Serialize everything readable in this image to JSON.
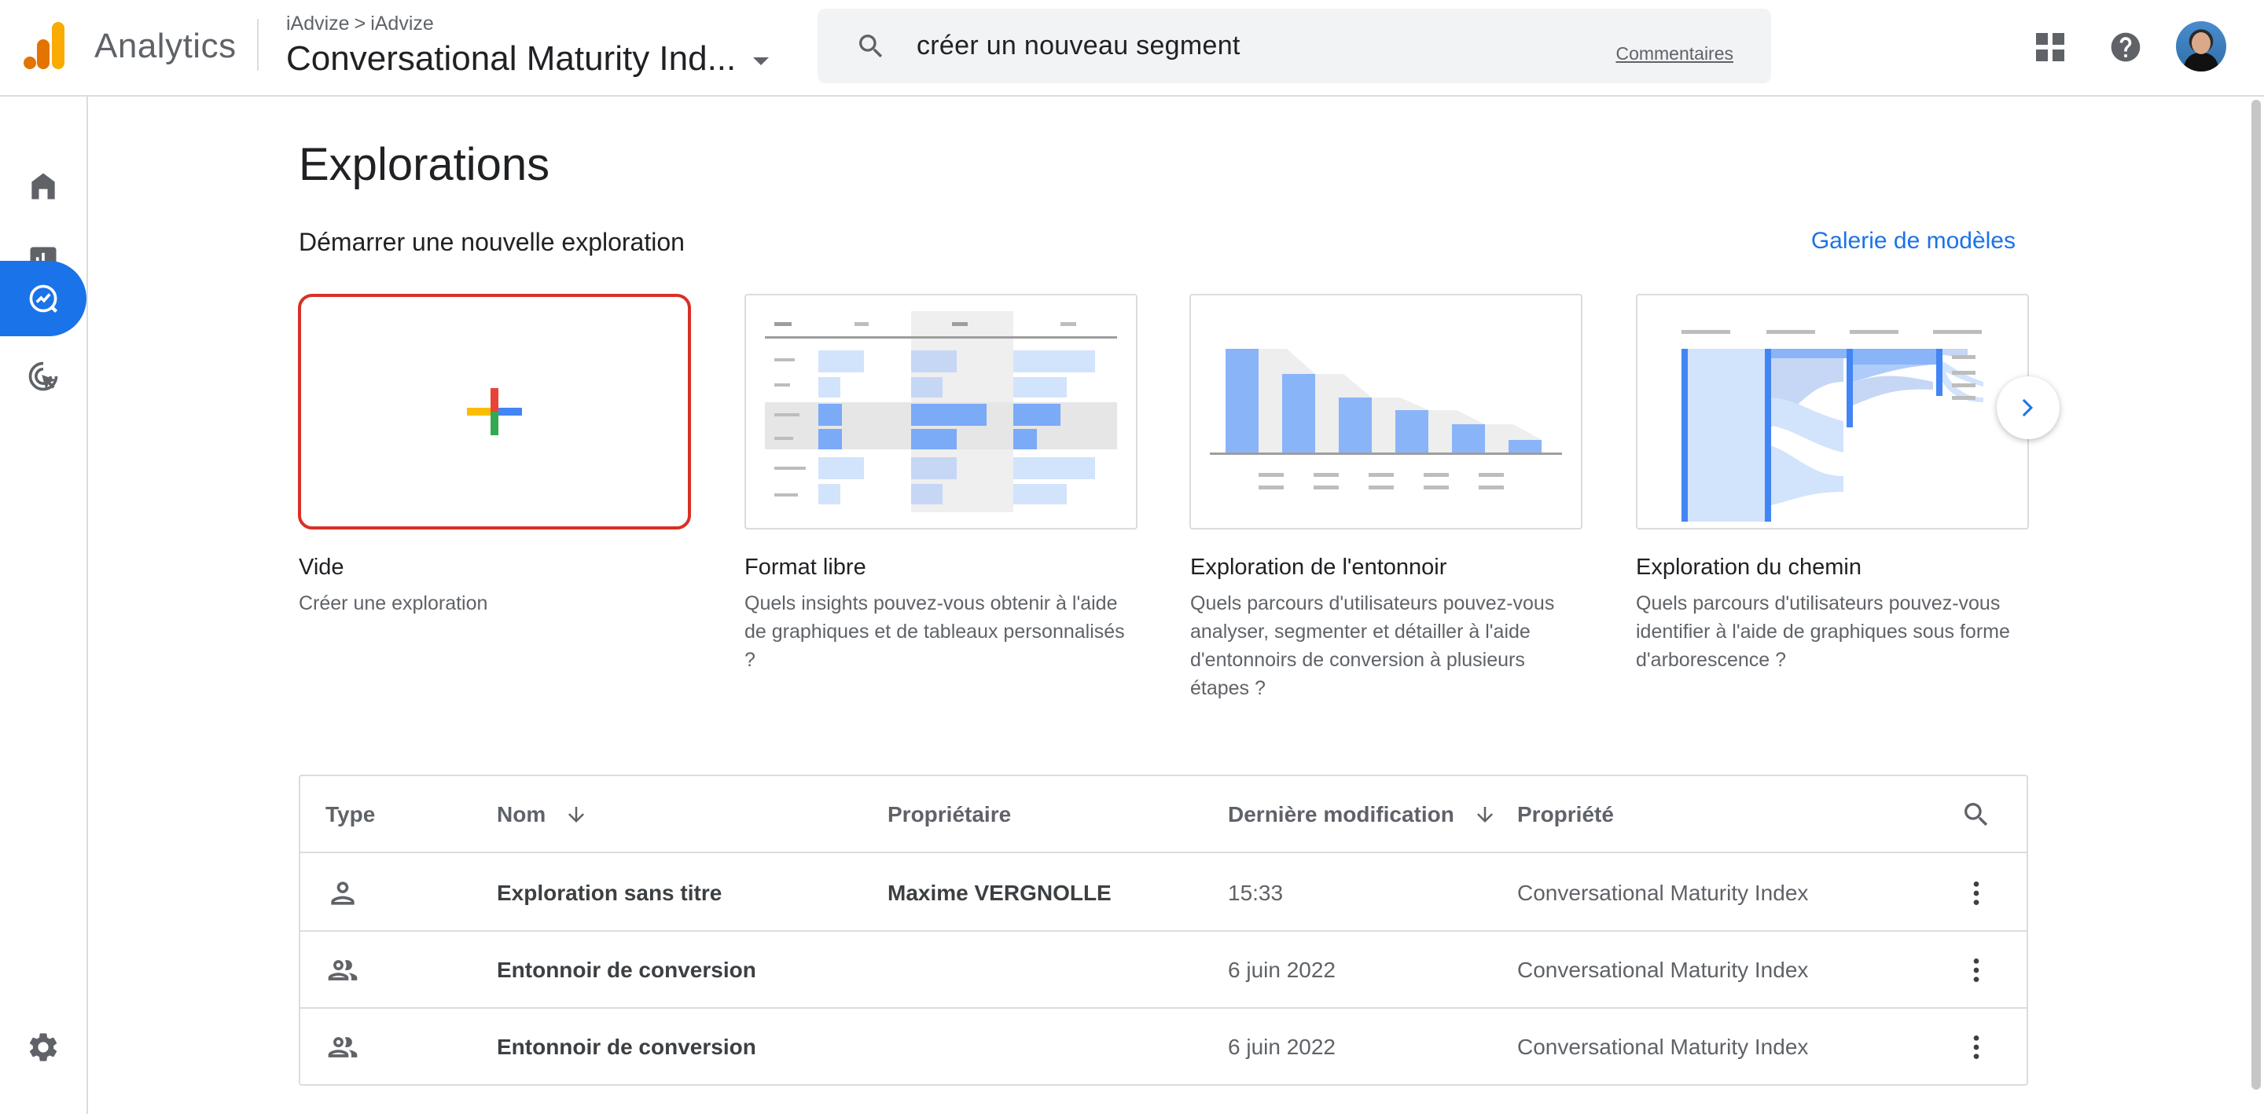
{
  "header": {
    "product_name": "Analytics",
    "breadcrumb": [
      "iAdvize",
      "iAdvize"
    ],
    "breadcrumb_sep": ">",
    "property_name": "Conversational Maturity Ind...",
    "search_value": "créer un nouveau segment",
    "search_feedback": "Commentaires"
  },
  "sidebar": {
    "items": [
      {
        "name": "home",
        "icon": "home-icon"
      },
      {
        "name": "reports",
        "icon": "bar-chart-icon"
      },
      {
        "name": "explore",
        "icon": "explore-icon",
        "active": true
      },
      {
        "name": "advertising",
        "icon": "ads-target-icon"
      }
    ],
    "settings_icon": "gear-icon"
  },
  "main": {
    "title": "Explorations",
    "section_title": "Démarrer une nouvelle exploration",
    "gallery_link": "Galerie de modèles",
    "templates": [
      {
        "name": "Vide",
        "desc": "Créer une exploration"
      },
      {
        "name": "Format libre",
        "desc": "Quels insights pouvez-vous obtenir à l'aide de graphiques et de tableaux personnalisés ?"
      },
      {
        "name": "Exploration de l'entonnoir",
        "desc": "Quels parcours d'utilisateurs pouvez-vous analyser, segmenter et détailler à l'aide d'entonnoirs de conversion à plusieurs étapes ?"
      },
      {
        "name": "Exploration du chemin",
        "desc": "Quels parcours d'utilisateurs pouvez-vous identifier à l'aide de graphiques sous forme d'arborescence ?"
      }
    ]
  },
  "table": {
    "headers": {
      "type": "Type",
      "name": "Nom",
      "owner": "Propriétaire",
      "modified": "Dernière modification",
      "property": "Propriété"
    },
    "rows": [
      {
        "type_icon": "person-icon",
        "name": "Exploration sans titre",
        "owner": "Maxime VERGNOLLE",
        "modified": "15:33",
        "property": "Conversational Maturity Index"
      },
      {
        "type_icon": "people-icon",
        "name": "Entonnoir de conversion",
        "owner": "",
        "modified": "6 juin 2022",
        "property": "Conversational Maturity Index"
      },
      {
        "type_icon": "people-icon",
        "name": "Entonnoir de conversion",
        "owner": "",
        "modified": "6 juin 2022",
        "property": "Conversational Maturity Index"
      }
    ]
  },
  "colors": {
    "accent": "#1a73e8",
    "selected_border": "#d93025",
    "logo_orange": "#f9ab00",
    "logo_dark_orange": "#e37400"
  }
}
